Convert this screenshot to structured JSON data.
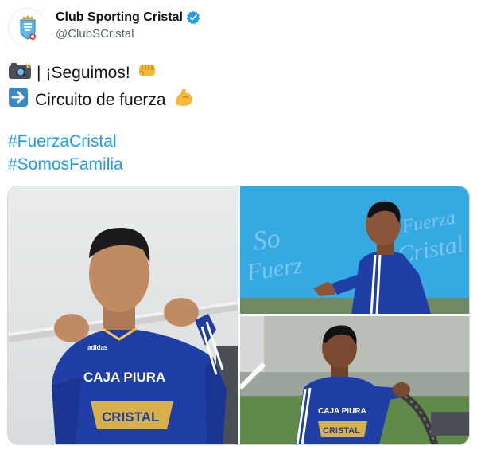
{
  "account": {
    "name": "Club Sporting Cristal",
    "handle": "@ClubSCristal",
    "avatar_icon": "club-crest-icon",
    "verified_icon": "verified-badge-icon"
  },
  "tweet": {
    "line1_prefix_icon": "camera-flash-icon",
    "line1_sep": "|",
    "line1_text": "¡Seguimos!",
    "line1_suffix_icon": "fist-icon",
    "line2_prefix_icon": "right-arrow-icon",
    "line2_text": "Circuito de fuerza",
    "line2_suffix_icon": "flexed-biceps-icon",
    "hashtags": [
      "#FuerzaCristal",
      "#SomosFamilia"
    ]
  },
  "media": {
    "photos": [
      {
        "label": "player-pullup-photo",
        "shirt_text_1": "CAJA PIURA",
        "shirt_text_2": "CRISTAL"
      },
      {
        "label": "player-sprint-photo"
      },
      {
        "label": "player-rope-photo",
        "shirt_text_1": "CAJA PIURA",
        "shirt_text_2": "CRISTAL"
      }
    ]
  },
  "colors": {
    "brand_blue": "#1d9bf0",
    "shirt_blue": "#1f3fa6",
    "sky_blue": "#35a9e1"
  }
}
